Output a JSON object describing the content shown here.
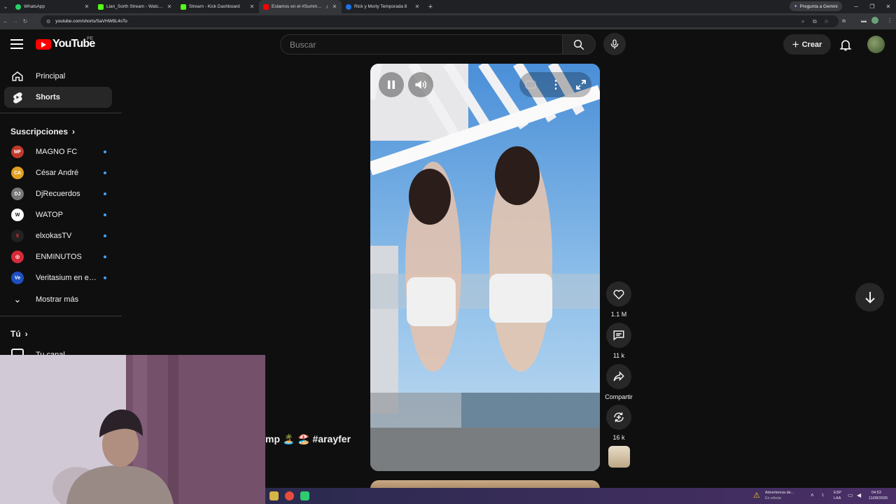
{
  "browser": {
    "tabs": [
      {
        "label": "WhatsApp",
        "color": "#25d366",
        "active": false
      },
      {
        "label": "Lian_Sorth Stream - Watch Liv",
        "color": "#53fc18",
        "active": false
      },
      {
        "label": "Stream - Kick Dashboard",
        "color": "#53fc18",
        "active": false
      },
      {
        "label": "Estamos en el #SummerKr",
        "color": "#ff0000",
        "active": true
      },
      {
        "label": "Rick y Morty Temporada 8",
        "color": "#1a73e8",
        "active": false
      }
    ],
    "gemini_label": "Pregunta a Gemini",
    "url": "youtube.com/shorts/SaVHW8L4sTo"
  },
  "youtube": {
    "logo_text": "YouTube",
    "country_code": "PE",
    "search_placeholder": "Buscar",
    "create_label": "Crear"
  },
  "sidebar": {
    "main": [
      {
        "label": "Principal",
        "icon": "home-icon"
      },
      {
        "label": "Shorts",
        "icon": "shorts-icon",
        "selected": true
      }
    ],
    "subscriptions_title": "Suscripciones",
    "subscriptions": [
      {
        "name": "MAGNO FC",
        "avatar": "#c0392b"
      },
      {
        "name": "César André",
        "avatar": "#e0a020"
      },
      {
        "name": "DjRecuerdos",
        "avatar": "#777777"
      },
      {
        "name": "WATOP",
        "avatar": "#ffffff"
      },
      {
        "name": "elxokasTV",
        "avatar": "#222222"
      },
      {
        "name": "ENMINUTOS",
        "avatar": "#d62a3a"
      },
      {
        "name": "Veritasium en es...",
        "avatar": "#1e4fbf"
      }
    ],
    "show_more": "Mostrar más",
    "you_title": "Tú",
    "your_channel": "Tu canal"
  },
  "short": {
    "caption": "mp 🏝️ 🏖️ #arayfer",
    "likes": "1.1 M",
    "comments": "11 k",
    "share": "Compartir",
    "remix": "16 k"
  },
  "taskbar": {
    "notice_title": "Advertencia de...",
    "notice_sub": "En efecto",
    "lang_top": "ESP",
    "lang_bottom": "LAA",
    "time": "04:53",
    "date": "11/08/2026"
  }
}
